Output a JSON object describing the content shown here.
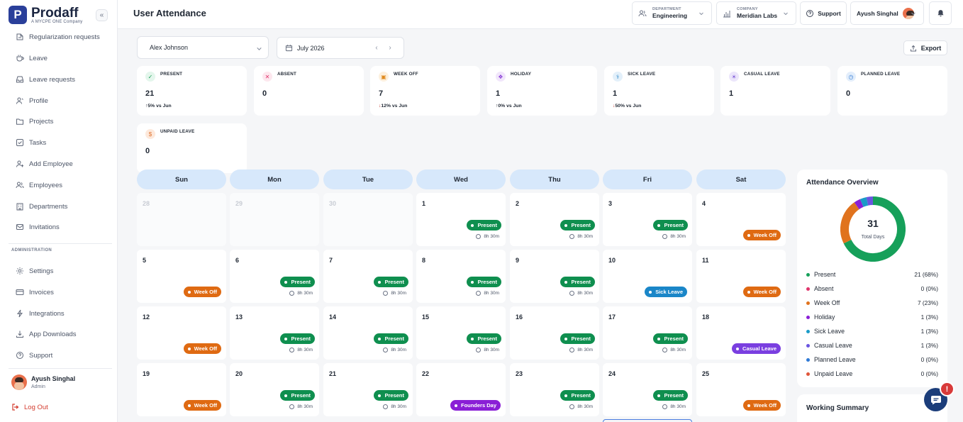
{
  "brand": {
    "name": "Prodaff",
    "tagline": "A MYCPE ONE Company",
    "mark": "P"
  },
  "sidebar": {
    "items": [
      {
        "label": "Regularization requests",
        "icon": "regularization-icon"
      },
      {
        "label": "Leave",
        "icon": "cup-icon"
      },
      {
        "label": "Leave requests",
        "icon": "inbox-icon"
      },
      {
        "label": "Profile",
        "icon": "user-icon"
      },
      {
        "label": "Projects",
        "icon": "folder-icon"
      },
      {
        "label": "Tasks",
        "icon": "checkbox-icon"
      },
      {
        "label": "Add Employee",
        "icon": "user-plus-icon"
      },
      {
        "label": "Employees",
        "icon": "users-icon"
      },
      {
        "label": "Departments",
        "icon": "building-icon"
      },
      {
        "label": "Invitations",
        "icon": "mail-icon"
      }
    ],
    "admin_heading": "ADMINISTRATION",
    "admin_items": [
      {
        "label": "Settings",
        "icon": "gear-icon"
      },
      {
        "label": "Invoices",
        "icon": "card-icon"
      },
      {
        "label": "Integrations",
        "icon": "plug-icon"
      },
      {
        "label": "App Downloads",
        "icon": "download-icon"
      },
      {
        "label": "Support",
        "icon": "help-icon"
      }
    ],
    "user": {
      "name": "Ayush Singhal",
      "role": "Admin"
    },
    "logout_label": "Log Out",
    "collapse_icon": "«"
  },
  "header": {
    "title": "User Attendance",
    "department": {
      "label": "DEPARTMENT",
      "value": "Engineering"
    },
    "company": {
      "label": "COMPANY",
      "value": "Meridian Labs"
    },
    "support_label": "Support",
    "user_name": "Ayush Singhal"
  },
  "toolbar": {
    "employee": "Alex Johnson",
    "month": "July 2026",
    "export_label": "Export"
  },
  "stats": [
    {
      "label": "PRESENT",
      "value": "21",
      "trend": "5% vs Jun",
      "dir": "up",
      "color": "#1a9e55",
      "bg": "#e4f6ec",
      "glyph": "✓"
    },
    {
      "label": "ABSENT",
      "value": "0",
      "trend": "",
      "dir": "",
      "color": "#e0356b",
      "bg": "#fde7ee",
      "glyph": "✕"
    },
    {
      "label": "WEEK OFF",
      "value": "7",
      "trend": "12% vs Jun",
      "dir": "down",
      "color": "#e08a1e",
      "bg": "#fdf0dd",
      "glyph": "▣"
    },
    {
      "label": "HOLIDAY",
      "value": "1",
      "trend": "0% vs Jun",
      "dir": "up",
      "color": "#8a3fd6",
      "bg": "#f1e6fb",
      "glyph": "❖"
    },
    {
      "label": "SICK LEAVE",
      "value": "1",
      "trend": "50% vs Jun",
      "dir": "down",
      "color": "#2a86c9",
      "bg": "#e3f0fa",
      "glyph": "⚕"
    },
    {
      "label": "CASUAL LEAVE",
      "value": "1",
      "trend": "",
      "dir": "",
      "color": "#7a55d8",
      "bg": "#ece6fb",
      "glyph": "☀"
    },
    {
      "label": "PLANNED LEAVE",
      "value": "0",
      "trend": "",
      "dir": "",
      "color": "#2f7ad6",
      "bg": "#e3eefb",
      "glyph": "◷"
    },
    {
      "label": "UNPAID LEAVE",
      "value": "0",
      "trend": "",
      "dir": "",
      "color": "#e07430",
      "bg": "#fde9dc",
      "glyph": "$"
    }
  ],
  "calendar": {
    "weekdays": [
      "Sun",
      "Mon",
      "Tue",
      "Wed",
      "Thu",
      "Fri",
      "Sat"
    ],
    "hours_label": "8h 30m",
    "weeks": [
      [
        {
          "d": "28",
          "m": true
        },
        {
          "d": "29",
          "m": true
        },
        {
          "d": "30",
          "m": true
        },
        {
          "d": "1",
          "s": "present"
        },
        {
          "d": "2",
          "s": "present"
        },
        {
          "d": "3",
          "s": "present"
        },
        {
          "d": "4",
          "s": "weekoff"
        }
      ],
      [
        {
          "d": "5",
          "s": "weekoff"
        },
        {
          "d": "6",
          "s": "present"
        },
        {
          "d": "7",
          "s": "present"
        },
        {
          "d": "8",
          "s": "present"
        },
        {
          "d": "9",
          "s": "present"
        },
        {
          "d": "10",
          "s": "sick"
        },
        {
          "d": "11",
          "s": "weekoff"
        }
      ],
      [
        {
          "d": "12",
          "s": "weekoff"
        },
        {
          "d": "13",
          "s": "present"
        },
        {
          "d": "14",
          "s": "present"
        },
        {
          "d": "15",
          "s": "present"
        },
        {
          "d": "16",
          "s": "present"
        },
        {
          "d": "17",
          "s": "present"
        },
        {
          "d": "18",
          "s": "casual"
        }
      ],
      [
        {
          "d": "19",
          "s": "weekoff"
        },
        {
          "d": "20",
          "s": "present"
        },
        {
          "d": "21",
          "s": "present"
        },
        {
          "d": "22",
          "s": "holiday"
        },
        {
          "d": "23",
          "s": "present"
        },
        {
          "d": "24",
          "s": "present"
        },
        {
          "d": "25",
          "s": "weekoff"
        }
      ]
    ],
    "status_labels": {
      "present": "Present",
      "weekoff": "Week Off",
      "sick": "Sick Leave",
      "casual": "Casual Leave",
      "holiday": "Founders Day"
    },
    "status_colors": {
      "present": "#0f8f4f",
      "weekoff": "#df6a12",
      "sick": "#1a86c8",
      "casual": "#7a3fe0",
      "holiday": "#8a1fd6"
    }
  },
  "overview": {
    "title": "Attendance Overview",
    "total": "31",
    "total_label": "Total Days",
    "legend": [
      {
        "label": "Present",
        "value": "21 (68%)",
        "count": 21,
        "color": "#16a05a"
      },
      {
        "label": "Absent",
        "value": "0 (0%)",
        "count": 0,
        "color": "#e0356b"
      },
      {
        "label": "Week Off",
        "value": "7 (23%)",
        "count": 7,
        "color": "#e0731e"
      },
      {
        "label": "Holiday",
        "value": "1 (3%)",
        "count": 1,
        "color": "#8a1fd6"
      },
      {
        "label": "Sick Leave",
        "value": "1 (3%)",
        "count": 1,
        "color": "#1a9bc8"
      },
      {
        "label": "Casual Leave",
        "value": "1 (3%)",
        "count": 1,
        "color": "#6a55e0"
      },
      {
        "label": "Planned Leave",
        "value": "0 (0%)",
        "count": 0,
        "color": "#2f7ad6"
      },
      {
        "label": "Unpaid Leave",
        "value": "0 (0%)",
        "count": 0,
        "color": "#e0563a"
      }
    ]
  },
  "working_summary": {
    "title": "Working Summary"
  },
  "chat": {
    "alert": "!"
  }
}
